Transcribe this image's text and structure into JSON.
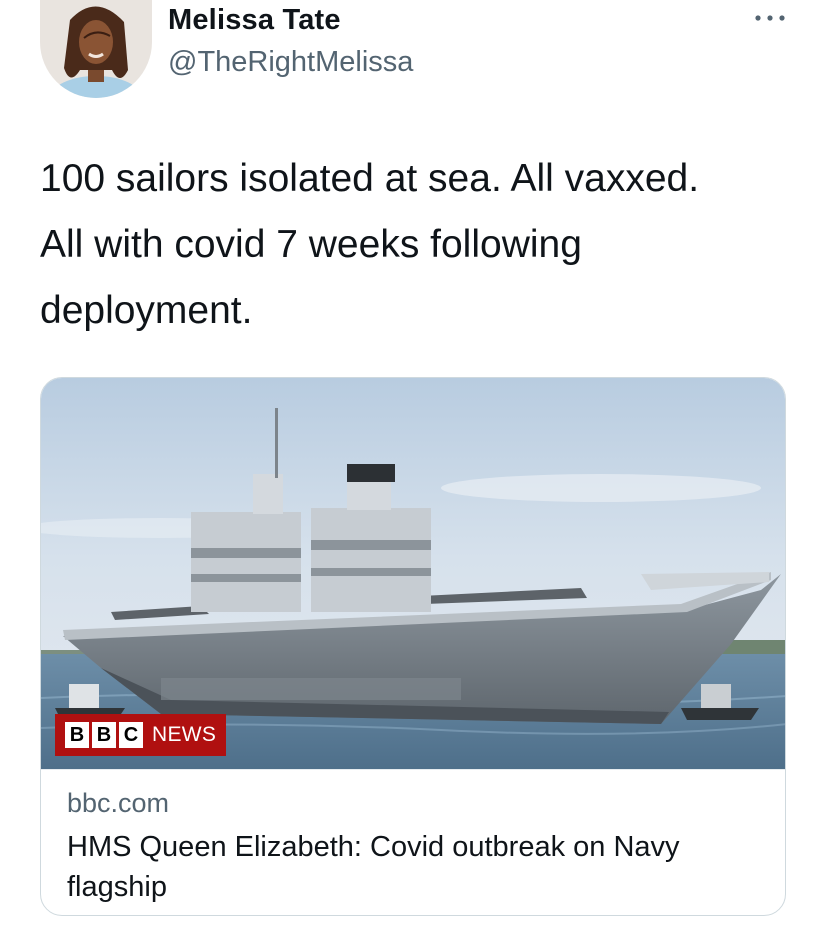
{
  "author": {
    "name": "Melissa Tate",
    "handle": "@TheRightMelissa",
    "avatar_icon": "profile-photo"
  },
  "more_icon": "ellipsis-icon",
  "tweet": {
    "lines": [
      "100 sailors isolated at sea. All vaxxed.",
      "All with covid 7 weeks following",
      "deployment."
    ]
  },
  "card": {
    "image_icon": "aircraft-carrier-photo",
    "badge": {
      "letters": [
        "B",
        "B",
        "C"
      ],
      "text": "NEWS"
    },
    "domain": "bbc.com",
    "title": "HMS Queen Elizabeth: Covid outbreak on Navy flagship"
  },
  "colors": {
    "text": "#0f1419",
    "secondary": "#536471",
    "border": "#cfd9de",
    "bbc_red": "#b01010"
  }
}
